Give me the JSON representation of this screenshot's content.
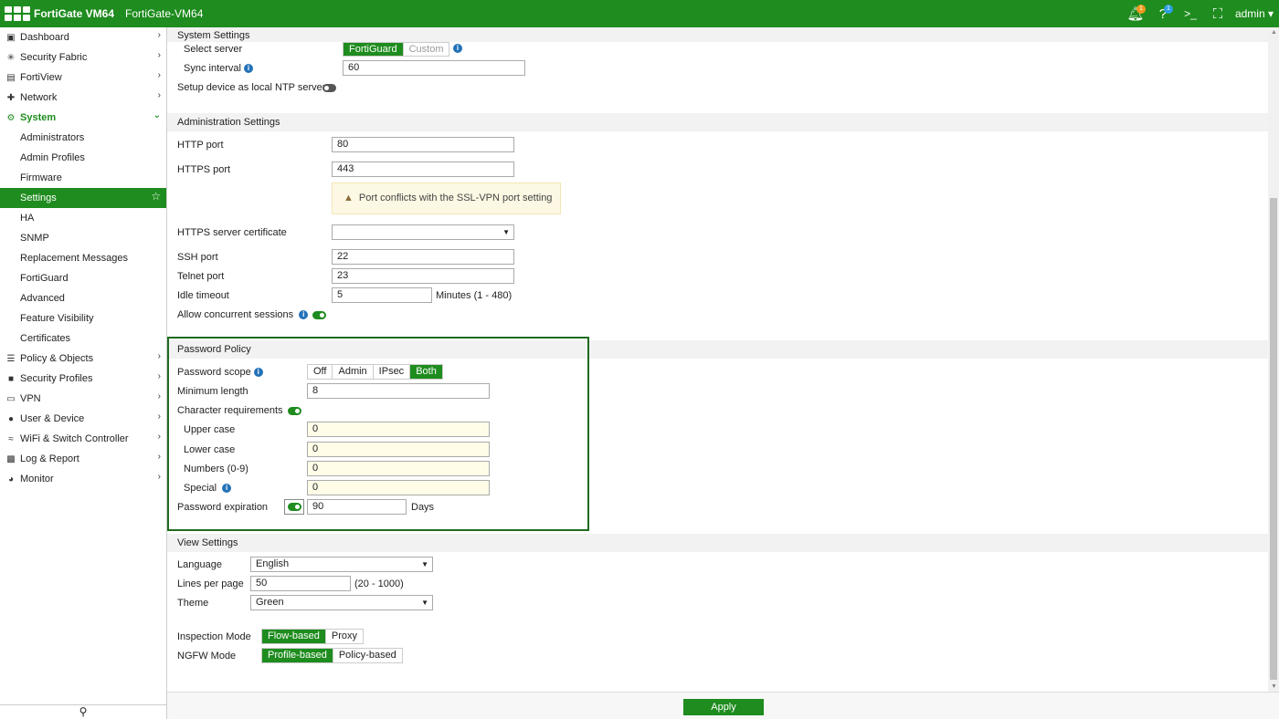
{
  "topbar": {
    "product": "FortiGate VM64",
    "hostname": "FortiGate-VM64",
    "notif_count": "1",
    "help_count": "1",
    "user": "admin"
  },
  "sidebar": {
    "items": [
      {
        "label": "Dashboard",
        "icon": "dashboard-icon",
        "chevron": ">"
      },
      {
        "label": "Security Fabric",
        "icon": "fabric-icon",
        "chevron": ">"
      },
      {
        "label": "FortiView",
        "icon": "fortiview-icon",
        "chevron": ">"
      },
      {
        "label": "Network",
        "icon": "network-icon",
        "chevron": ">"
      },
      {
        "label": "System",
        "icon": "gear-icon",
        "chevron": "v"
      },
      {
        "label": "Administrators"
      },
      {
        "label": "Admin Profiles"
      },
      {
        "label": "Firmware"
      },
      {
        "label": "Settings"
      },
      {
        "label": "HA"
      },
      {
        "label": "SNMP"
      },
      {
        "label": "Replacement Messages"
      },
      {
        "label": "FortiGuard"
      },
      {
        "label": "Advanced"
      },
      {
        "label": "Feature Visibility"
      },
      {
        "label": "Certificates"
      },
      {
        "label": "Policy & Objects",
        "icon": "policy-icon",
        "chevron": ">"
      },
      {
        "label": "Security Profiles",
        "icon": "lock-icon",
        "chevron": ">"
      },
      {
        "label": "VPN",
        "icon": "vpn-icon",
        "chevron": ">"
      },
      {
        "label": "User & Device",
        "icon": "user-icon",
        "chevron": ">"
      },
      {
        "label": "WiFi & Switch Controller",
        "icon": "wifi-icon",
        "chevron": ">"
      },
      {
        "label": "Log & Report",
        "icon": "chart-icon",
        "chevron": ">"
      },
      {
        "label": "Monitor",
        "icon": "pie-icon",
        "chevron": ">"
      }
    ]
  },
  "system_settings": {
    "header": "System Settings",
    "select_server_label": "Select server",
    "server_options": [
      "FortiGuard",
      "Custom"
    ],
    "sync_interval_label": "Sync interval",
    "sync_interval_value": "60",
    "local_ntp_label": "Setup device as local NTP server"
  },
  "admin_settings": {
    "header": "Administration Settings",
    "http_port_label": "HTTP port",
    "http_port": "80",
    "https_port_label": "HTTPS port",
    "https_port": "443",
    "warning": "Port conflicts with the SSL-VPN port setting",
    "https_cert_label": "HTTPS server certificate",
    "https_cert": "",
    "ssh_port_label": "SSH port",
    "ssh_port": "22",
    "telnet_port_label": "Telnet port",
    "telnet_port": "23",
    "idle_timeout_label": "Idle timeout",
    "idle_timeout": "5",
    "idle_timeout_unit": "Minutes (1 - 480)",
    "concurrent_label": "Allow concurrent sessions"
  },
  "password_policy": {
    "header": "Password Policy",
    "scope_label": "Password scope",
    "scope_options": [
      "Off",
      "Admin",
      "IPsec",
      "Both"
    ],
    "min_length_label": "Minimum length",
    "min_length": "8",
    "char_req_label": "Character requirements",
    "upper_label": "Upper case",
    "upper": "0",
    "lower_label": "Lower case",
    "lower": "0",
    "numbers_label": "Numbers (0-9)",
    "numbers": "0",
    "special_label": "Special",
    "special": "0",
    "expiration_label": "Password expiration",
    "expiration": "90",
    "expiration_unit": "Days"
  },
  "view_settings": {
    "header": "View Settings",
    "language_label": "Language",
    "language": "English",
    "lines_label": "Lines per page",
    "lines": "50",
    "lines_range": "(20 - 1000)",
    "theme_label": "Theme",
    "theme": "Green",
    "inspection_label": "Inspection Mode",
    "inspection_options": [
      "Flow-based",
      "Proxy"
    ],
    "ngfw_label": "NGFW Mode",
    "ngfw_options": [
      "Profile-based",
      "Policy-based"
    ]
  },
  "footer": {
    "apply": "Apply"
  }
}
